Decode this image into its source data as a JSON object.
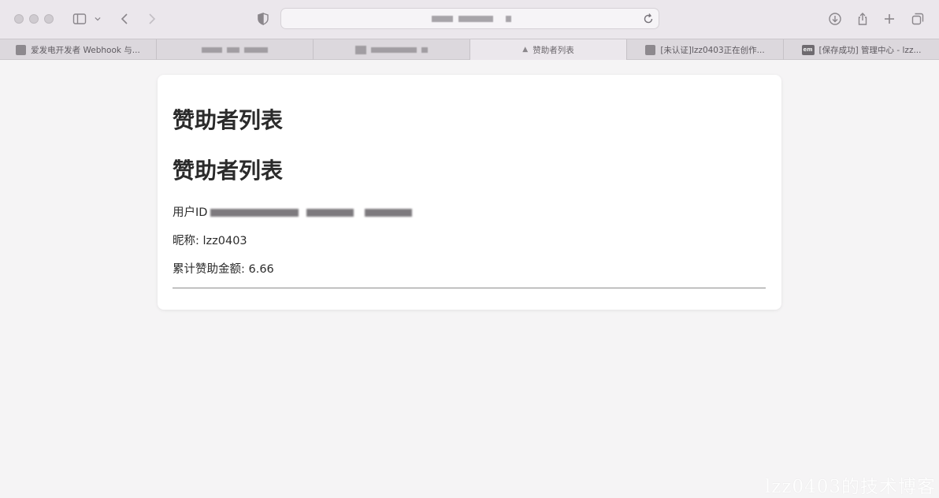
{
  "tabs": [
    {
      "label": "爱发电开发者 Webhook 与...",
      "favicon": "ifdian-favicon"
    },
    {
      "label": "",
      "favicon": "blurred-favicon"
    },
    {
      "label": "",
      "favicon": "blurred-favicon"
    },
    {
      "label": "赞助者列表",
      "favicon": "page-icon"
    },
    {
      "label": "[未认证]lzz0403正在创作...",
      "favicon": "ifdian-favicon"
    },
    {
      "label": "[保存成功] 管理中心 - lzz...",
      "favicon": "em-favicon",
      "favicon_text": "em"
    }
  ],
  "page": {
    "heading_1": "赞助者列表",
    "heading_2": "赞助者列表",
    "user_id_label": "用户ID",
    "nickname_text": "昵称: lzz0403",
    "amount_text": "累计赞助金额: 6.66"
  },
  "watermark": "lzz0403的技术博客",
  "colors": {
    "toolbar": "#ebe7ec",
    "tabbar": "#dcd8dd",
    "page_bg": "#f5f4f5",
    "card": "#ffffff"
  }
}
